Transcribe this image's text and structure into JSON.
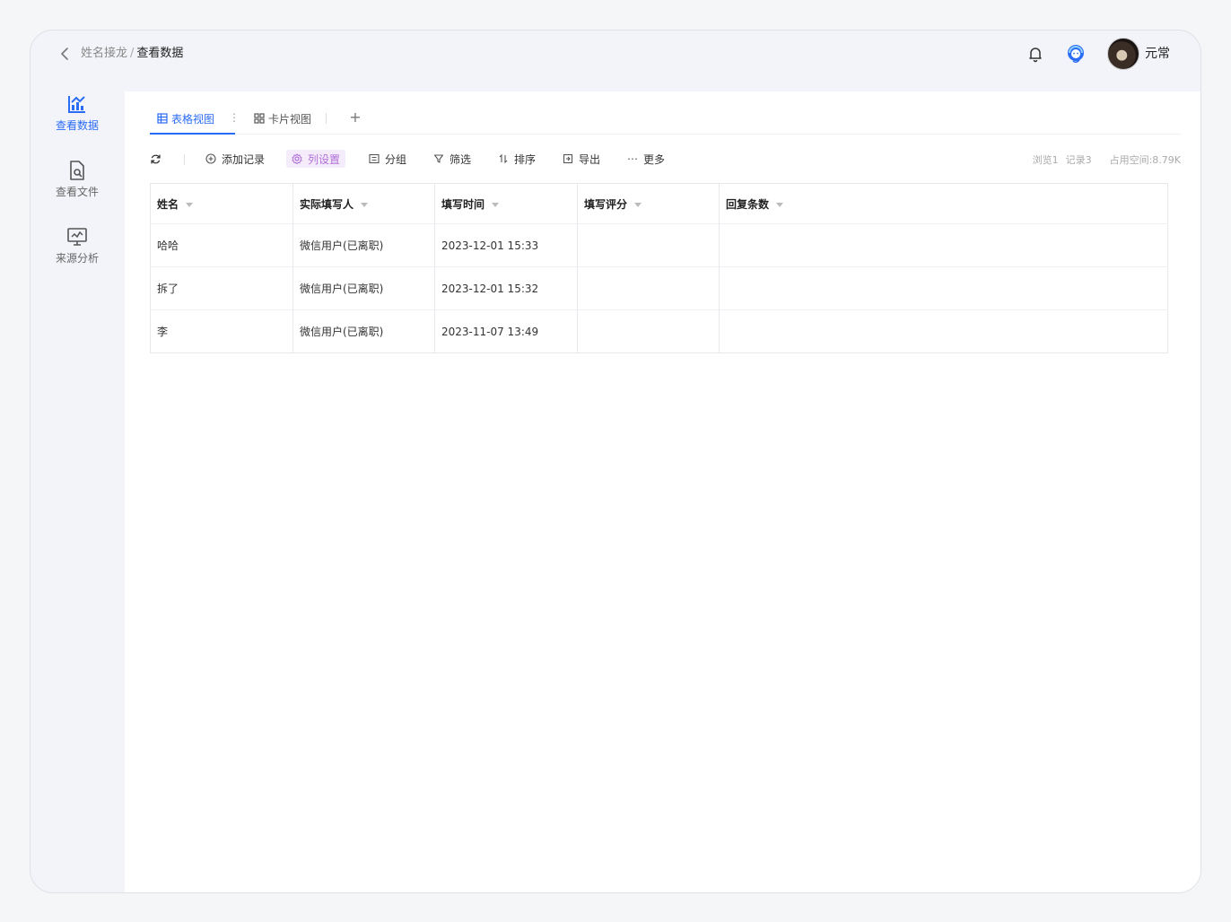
{
  "breadcrumb": {
    "parent": "姓名接龙",
    "separator": "/",
    "current": "查看数据"
  },
  "header": {
    "username": "元常"
  },
  "sidebar": {
    "items": [
      {
        "label": "查看数据",
        "icon": "chart-icon",
        "active": true
      },
      {
        "label": "查看文件",
        "icon": "file-search-icon",
        "active": false
      },
      {
        "label": "来源分析",
        "icon": "monitor-analytics-icon",
        "active": false
      }
    ]
  },
  "tabs": [
    {
      "label": "表格视图",
      "icon": "table-icon",
      "active": true
    },
    {
      "label": "卡片视图",
      "icon": "grid-icon",
      "active": false
    }
  ],
  "toolbar": {
    "add_record": "添加记录",
    "column_settings": "列设置",
    "group": "分组",
    "filter": "筛选",
    "sort": "排序",
    "export": "导出",
    "more": "更多"
  },
  "stats": {
    "views": "浏览1",
    "records": "记录3",
    "storage": "占用空间:8.79K"
  },
  "table": {
    "columns": [
      "姓名",
      "实际填写人",
      "填写时间",
      "填写评分",
      "回复条数"
    ],
    "rows": [
      [
        "哈哈",
        "微信用户(已离职)",
        "2023-12-01 15:33",
        "",
        ""
      ],
      [
        "拆了",
        "微信用户(已离职)",
        "2023-12-01 15:32",
        "",
        ""
      ],
      [
        "李",
        "微信用户(已离职)",
        "2023-11-07 13:49",
        "",
        ""
      ]
    ]
  },
  "colors": {
    "accent": "#2b6cf5",
    "column_settings_highlight": "#b06fd8"
  }
}
